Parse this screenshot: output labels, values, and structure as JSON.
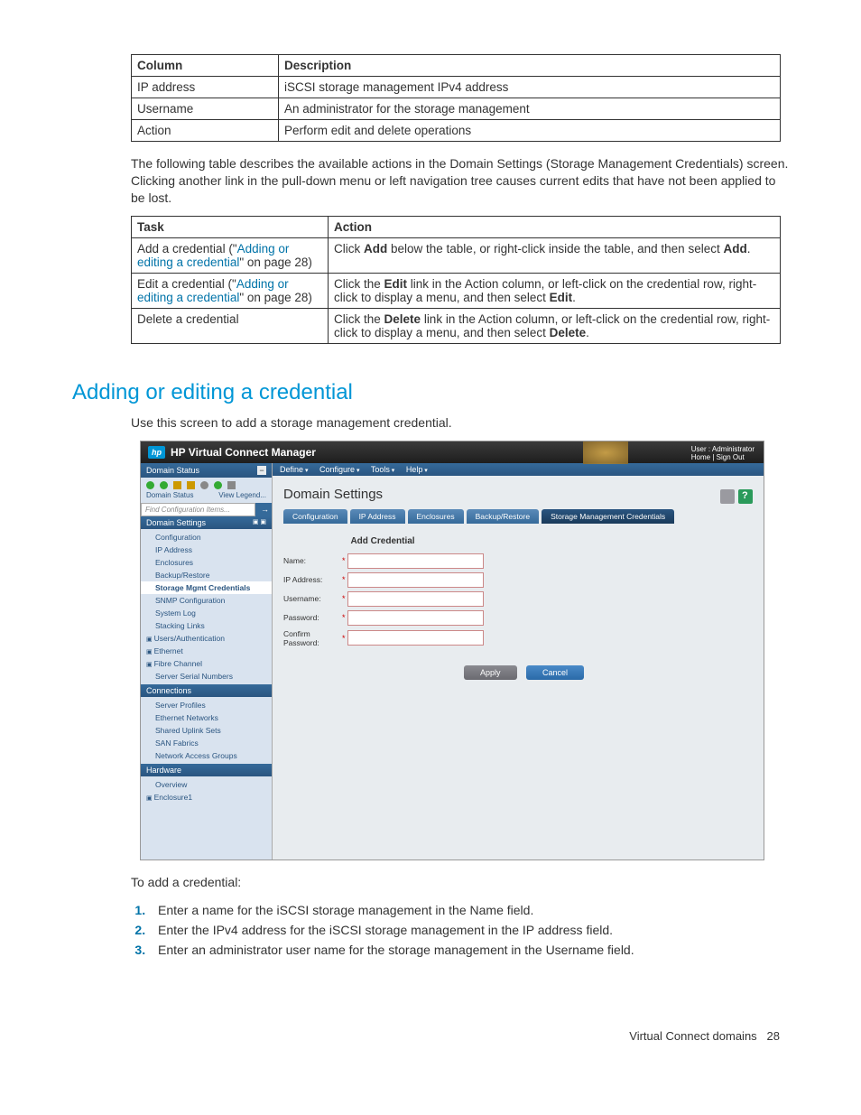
{
  "table1": {
    "headers": [
      "Column",
      "Description"
    ],
    "rows": [
      [
        "IP address",
        "iSCSI storage management IPv4 address"
      ],
      [
        "Username",
        "An administrator for the storage management"
      ],
      [
        "Action",
        "Perform edit and delete operations"
      ]
    ]
  },
  "para1": "The following table describes the available actions in the Domain Settings (Storage Management Credentials) screen. Clicking another link in the pull-down menu or left navigation tree causes current edits that have not been applied to be lost.",
  "table2": {
    "headers": [
      "Task",
      "Action"
    ],
    "rows": [
      {
        "task_prefix": "Add a credential (\"",
        "task_link": "Adding or editing a credential",
        "task_suffix": "\" on page 28)",
        "action_pre": "Click ",
        "action_b1": "Add",
        "action_mid": " below the table, or right-click inside the table, and then select ",
        "action_b2": "Add",
        "action_post": "."
      },
      {
        "task_prefix": "Edit a credential (\"",
        "task_link": "Adding or editing a credential",
        "task_suffix": "\" on page 28)",
        "action_pre": "Click the ",
        "action_b1": "Edit",
        "action_mid": " link in the Action column, or left-click on the credential row, right-click to display a menu, and then select ",
        "action_b2": "Edit",
        "action_post": "."
      },
      {
        "task_plain": "Delete a credential",
        "action_pre": "Click the ",
        "action_b1": "Delete",
        "action_mid": " link in the Action column, or left-click on the credential row, right-click to display a menu, and then select ",
        "action_b2": "Delete",
        "action_post": "."
      }
    ]
  },
  "heading": "Adding or editing a credential",
  "para2": "Use this screen to add a storage management credential.",
  "vc": {
    "title": "HP Virtual Connect Manager",
    "user_label": "User : Administrator",
    "home": "Home",
    "signout": "Sign Out",
    "domain_status": "Domain Status",
    "domain_status_label": "Domain Status",
    "view_legend": "View Legend...",
    "search_placeholder": "Find Configuration Items...",
    "nav_domain_settings": "Domain Settings",
    "nav_items_ds": [
      "Configuration",
      "IP Address",
      "Enclosures",
      "Backup/Restore",
      "Storage Mgmt Credentials",
      "SNMP Configuration",
      "System Log",
      "Stacking Links"
    ],
    "nav_users": "Users/Authentication",
    "nav_ethernet": "Ethernet",
    "nav_fc": "Fibre Channel",
    "nav_ssn": "Server Serial Numbers",
    "nav_connections": "Connections",
    "nav_items_conn": [
      "Server Profiles",
      "Ethernet Networks",
      "Shared Uplink Sets",
      "SAN Fabrics",
      "Network Access Groups"
    ],
    "nav_hardware": "Hardware",
    "nav_overview": "Overview",
    "nav_enc": "Enclosure1",
    "menu": [
      "Define",
      "Configure",
      "Tools",
      "Help"
    ],
    "page_title": "Domain Settings",
    "tabs": [
      "Configuration",
      "IP Address",
      "Enclosures",
      "Backup/Restore",
      "Storage Management Credentials"
    ],
    "form_title": "Add Credential",
    "form_labels": {
      "name": "Name:",
      "ip": "IP Address:",
      "user": "Username:",
      "pass": "Password:",
      "confirm": "Confirm Password:"
    },
    "btn_apply": "Apply",
    "btn_cancel": "Cancel"
  },
  "para3": "To add a credential:",
  "steps": [
    "Enter a name for the iSCSI storage management in the Name field.",
    "Enter the IPv4 address for the iSCSI storage management in the IP address field.",
    "Enter an administrator user name for the storage management in the Username field."
  ],
  "footer_text": "Virtual Connect domains",
  "footer_page": "28"
}
